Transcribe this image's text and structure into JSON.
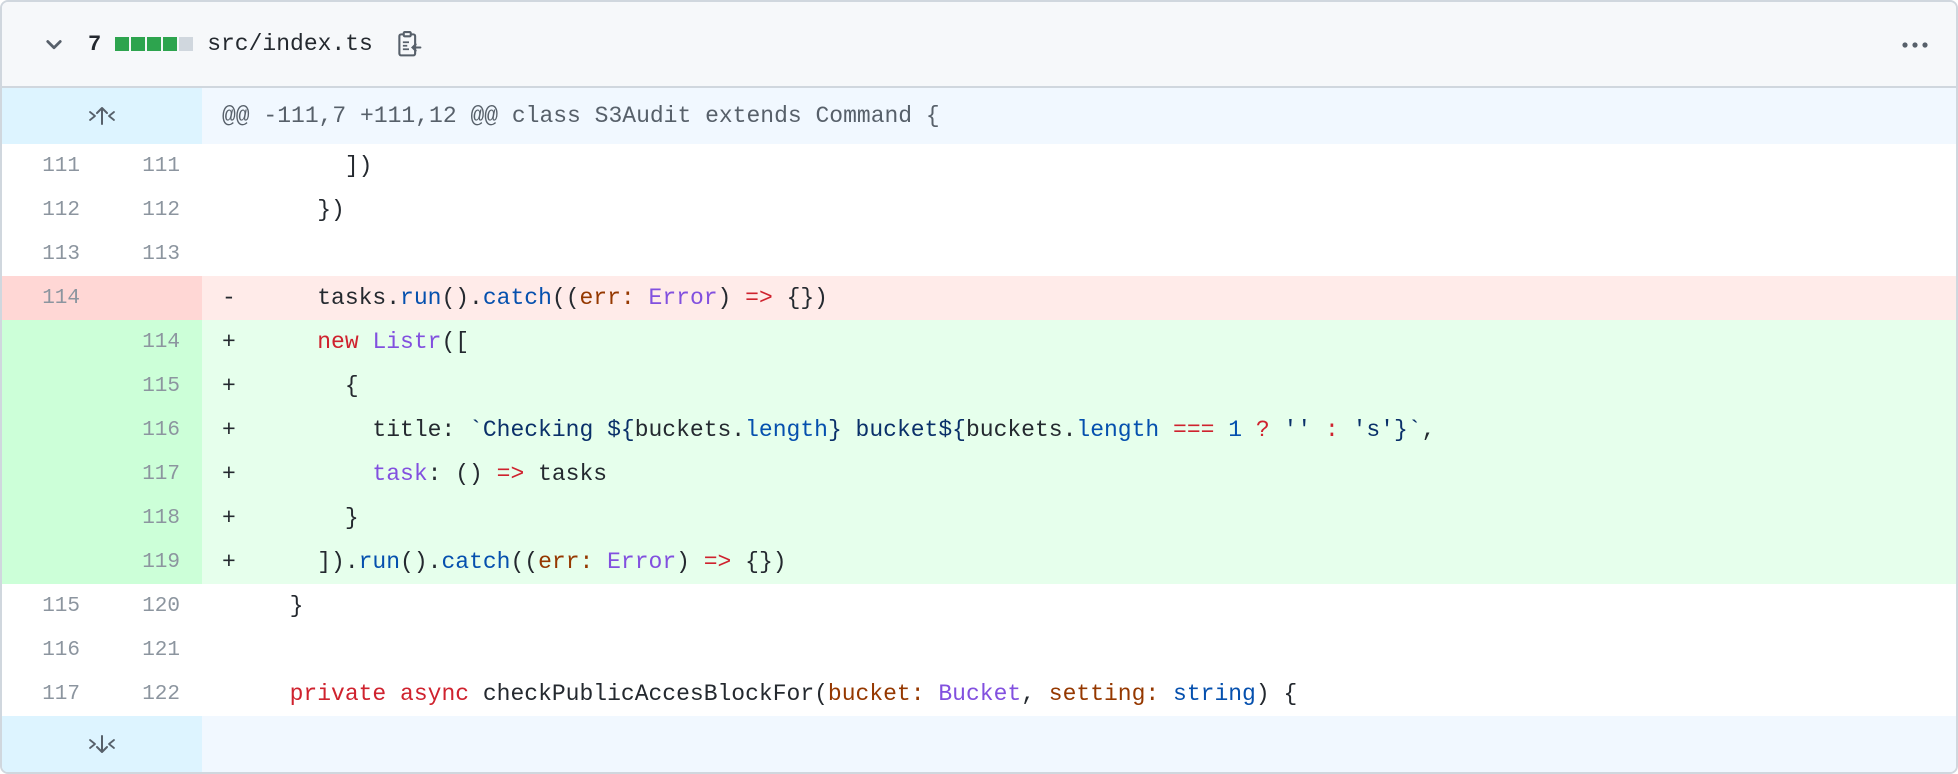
{
  "file": {
    "change_count": "7",
    "diffstat": [
      "add",
      "add",
      "add",
      "add",
      "neutral"
    ],
    "name": "src/index.ts"
  },
  "hunk_header": "@@ -111,7 +111,12 @@ class S3Audit extends Command {",
  "lines": [
    {
      "type": "ctx",
      "old": "111",
      "new": "111",
      "marker": "",
      "tokens": [
        [
          "plain",
          "      ])"
        ]
      ]
    },
    {
      "type": "ctx",
      "old": "112",
      "new": "112",
      "marker": "",
      "tokens": [
        [
          "plain",
          "    })"
        ]
      ]
    },
    {
      "type": "ctx",
      "old": "113",
      "new": "113",
      "marker": "",
      "tokens": [
        [
          "plain",
          ""
        ]
      ]
    },
    {
      "type": "del",
      "old": "114",
      "new": "",
      "marker": "-",
      "tokens": [
        [
          "plain",
          "    tasks."
        ],
        [
          "prop",
          "run"
        ],
        [
          "plain",
          "()."
        ],
        [
          "prop",
          "catch"
        ],
        [
          "plain",
          "(("
        ],
        [
          "param",
          "err:"
        ],
        [
          "plain",
          " "
        ],
        [
          "fn",
          "Error"
        ],
        [
          "plain",
          ") "
        ],
        [
          "op",
          "=>"
        ],
        [
          "plain",
          " {})"
        ]
      ]
    },
    {
      "type": "add",
      "old": "",
      "new": "114",
      "marker": "+",
      "tokens": [
        [
          "plain",
          "    "
        ],
        [
          "kw",
          "new"
        ],
        [
          "plain",
          " "
        ],
        [
          "fn",
          "Listr"
        ],
        [
          "plain",
          "(["
        ]
      ]
    },
    {
      "type": "add",
      "old": "",
      "new": "115",
      "marker": "+",
      "tokens": [
        [
          "plain",
          "      {"
        ]
      ]
    },
    {
      "type": "add",
      "old": "",
      "new": "116",
      "marker": "+",
      "tokens": [
        [
          "plain",
          "        title: "
        ],
        [
          "str",
          "`Checking ${"
        ],
        [
          "plain",
          "buckets."
        ],
        [
          "prop",
          "length"
        ],
        [
          "str",
          "} bucket${"
        ],
        [
          "plain",
          "buckets."
        ],
        [
          "prop",
          "length"
        ],
        [
          "plain",
          " "
        ],
        [
          "op",
          "==="
        ],
        [
          "plain",
          " "
        ],
        [
          "num-lit",
          "1"
        ],
        [
          "plain",
          " "
        ],
        [
          "op",
          "?"
        ],
        [
          "plain",
          " "
        ],
        [
          "str",
          "''"
        ],
        [
          "plain",
          " "
        ],
        [
          "op",
          ":"
        ],
        [
          "plain",
          " "
        ],
        [
          "str",
          "'s'}`"
        ],
        [
          "plain",
          ","
        ]
      ]
    },
    {
      "type": "add",
      "old": "",
      "new": "117",
      "marker": "+",
      "tokens": [
        [
          "plain",
          "        "
        ],
        [
          "fn",
          "task"
        ],
        [
          "plain",
          ": () "
        ],
        [
          "op",
          "=>"
        ],
        [
          "plain",
          " tasks"
        ]
      ]
    },
    {
      "type": "add",
      "old": "",
      "new": "118",
      "marker": "+",
      "tokens": [
        [
          "plain",
          "      }"
        ]
      ]
    },
    {
      "type": "add",
      "old": "",
      "new": "119",
      "marker": "+",
      "tokens": [
        [
          "plain",
          "    ])."
        ],
        [
          "prop",
          "run"
        ],
        [
          "plain",
          "()."
        ],
        [
          "prop",
          "catch"
        ],
        [
          "plain",
          "(("
        ],
        [
          "param",
          "err:"
        ],
        [
          "plain",
          " "
        ],
        [
          "fn",
          "Error"
        ],
        [
          "plain",
          ") "
        ],
        [
          "op",
          "=>"
        ],
        [
          "plain",
          " {})"
        ]
      ]
    },
    {
      "type": "ctx",
      "old": "115",
      "new": "120",
      "marker": "",
      "tokens": [
        [
          "plain",
          "  }"
        ]
      ]
    },
    {
      "type": "ctx",
      "old": "116",
      "new": "121",
      "marker": "",
      "tokens": [
        [
          "plain",
          ""
        ]
      ]
    },
    {
      "type": "ctx",
      "old": "117",
      "new": "122",
      "marker": "",
      "tokens": [
        [
          "plain",
          "  "
        ],
        [
          "kw",
          "private"
        ],
        [
          "plain",
          " "
        ],
        [
          "kw",
          "async"
        ],
        [
          "plain",
          " checkPublicAccesBlockFor("
        ],
        [
          "param",
          "bucket:"
        ],
        [
          "plain",
          " "
        ],
        [
          "fn",
          "Bucket"
        ],
        [
          "plain",
          ", "
        ],
        [
          "param",
          "setting:"
        ],
        [
          "plain",
          " "
        ],
        [
          "prop",
          "string"
        ],
        [
          "plain",
          ") {"
        ]
      ]
    }
  ],
  "icons": {
    "collapse": "chevron-down-icon",
    "copy": "copy-path-icon",
    "more": "kebab-horizontal-icon",
    "expand_up": "unfold-up-icon",
    "expand_down": "unfold-down-icon"
  }
}
